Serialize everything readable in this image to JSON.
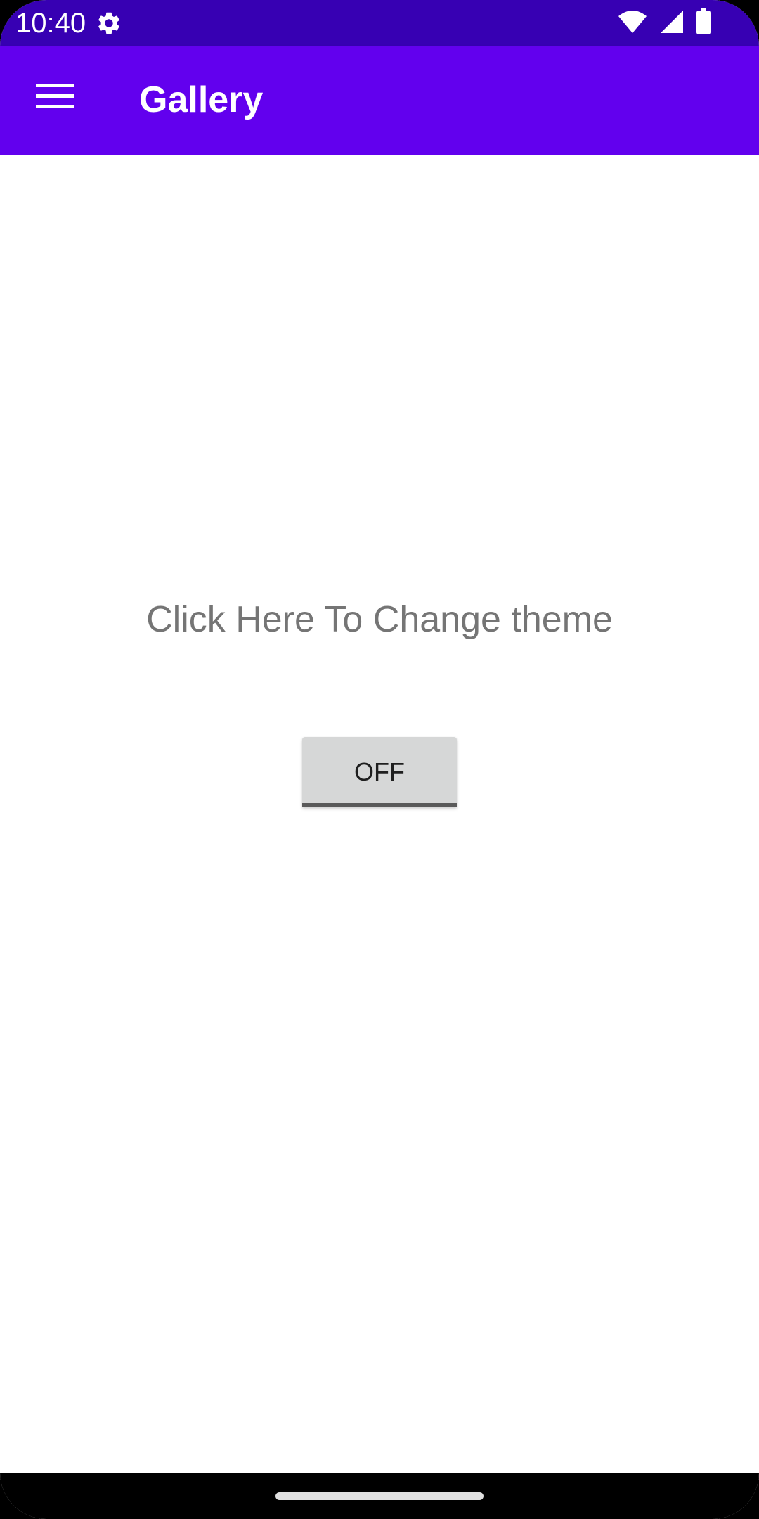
{
  "status_bar": {
    "time": "10:40",
    "icons": [
      "gear-icon",
      "wifi-icon",
      "signal-icon",
      "battery-icon"
    ],
    "color": "#3700b3"
  },
  "app_bar": {
    "title": "Gallery",
    "menu_icon": "hamburger-menu-icon",
    "color": "#6200ee"
  },
  "main": {
    "label": "Click Here To Change theme",
    "toggle": {
      "label": "OFF",
      "checked": false
    }
  },
  "nav_bar": {
    "handle": "home-gesture-handle"
  }
}
